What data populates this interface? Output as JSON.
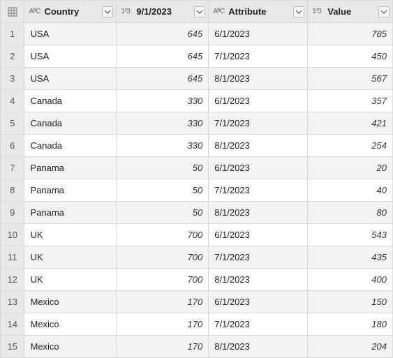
{
  "columns": [
    {
      "name": "Country",
      "type_label": "AᴮC",
      "kind": "text"
    },
    {
      "name": "9/1/2023",
      "type_label": "1²3",
      "kind": "number"
    },
    {
      "name": "Attribute",
      "type_label": "AᴮC",
      "kind": "text"
    },
    {
      "name": "Value",
      "type_label": "1²3",
      "kind": "number"
    }
  ],
  "rows": [
    {
      "n": 1,
      "country": "USA",
      "sep": "645",
      "attr": "6/1/2023",
      "value": "785"
    },
    {
      "n": 2,
      "country": "USA",
      "sep": "645",
      "attr": "7/1/2023",
      "value": "450"
    },
    {
      "n": 3,
      "country": "USA",
      "sep": "645",
      "attr": "8/1/2023",
      "value": "567"
    },
    {
      "n": 4,
      "country": "Canada",
      "sep": "330",
      "attr": "6/1/2023",
      "value": "357"
    },
    {
      "n": 5,
      "country": "Canada",
      "sep": "330",
      "attr": "7/1/2023",
      "value": "421"
    },
    {
      "n": 6,
      "country": "Canada",
      "sep": "330",
      "attr": "8/1/2023",
      "value": "254"
    },
    {
      "n": 7,
      "country": "Panama",
      "sep": "50",
      "attr": "6/1/2023",
      "value": "20"
    },
    {
      "n": 8,
      "country": "Panama",
      "sep": "50",
      "attr": "7/1/2023",
      "value": "40"
    },
    {
      "n": 9,
      "country": "Panama",
      "sep": "50",
      "attr": "8/1/2023",
      "value": "80"
    },
    {
      "n": 10,
      "country": "UK",
      "sep": "700",
      "attr": "6/1/2023",
      "value": "543"
    },
    {
      "n": 11,
      "country": "UK",
      "sep": "700",
      "attr": "7/1/2023",
      "value": "435"
    },
    {
      "n": 12,
      "country": "UK",
      "sep": "700",
      "attr": "8/1/2023",
      "value": "400"
    },
    {
      "n": 13,
      "country": "Mexico",
      "sep": "170",
      "attr": "6/1/2023",
      "value": "150"
    },
    {
      "n": 14,
      "country": "Mexico",
      "sep": "170",
      "attr": "7/1/2023",
      "value": "180"
    },
    {
      "n": 15,
      "country": "Mexico",
      "sep": "170",
      "attr": "8/1/2023",
      "value": "204"
    }
  ]
}
